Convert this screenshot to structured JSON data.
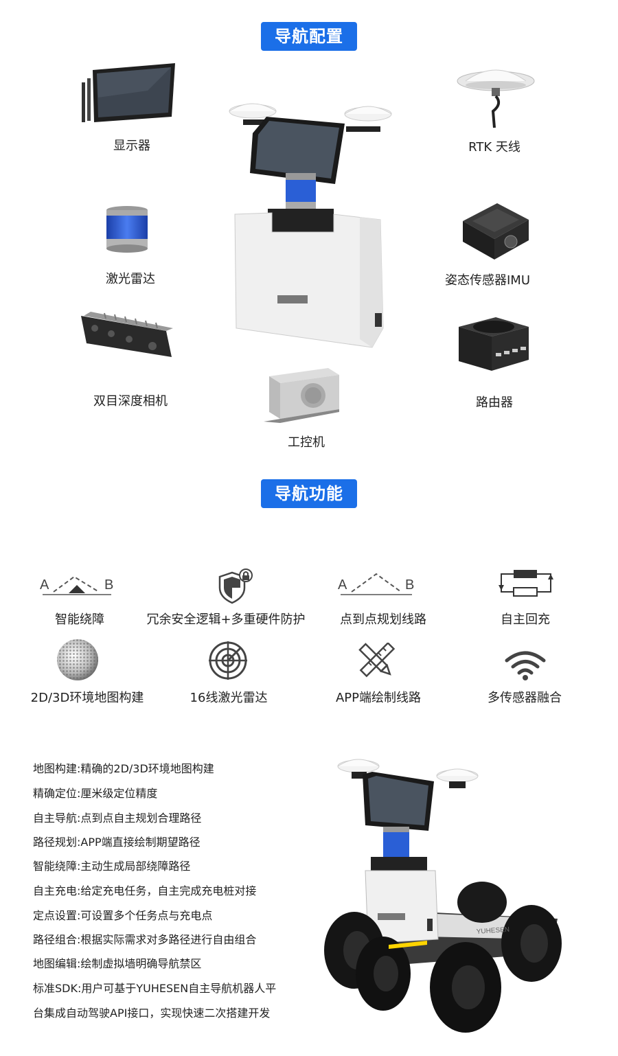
{
  "sections": {
    "config_title": "导航配置",
    "function_title": "导航功能"
  },
  "config_items": {
    "display": "显示器",
    "rtk_antenna": "RTK 天线",
    "lidar": "激光雷达",
    "imu": "姿态传感器IMU",
    "depth_camera": "双目深度相机",
    "router": "路由器",
    "ipc": "工控机"
  },
  "features": [
    {
      "label": "智能绕障",
      "icon": "obstacle-avoid-icon"
    },
    {
      "label": "冗余安全逻辑+多重硬件防护",
      "icon": "shield-lock-icon"
    },
    {
      "label": "点到点规划线路",
      "icon": "point-to-point-icon"
    },
    {
      "label": "自主回充",
      "icon": "battery-recharge-icon"
    },
    {
      "label": "2D/3D环境地图构建",
      "icon": "sphere-map-icon"
    },
    {
      "label": "16线激光雷达",
      "icon": "radar-icon"
    },
    {
      "label": "APP端绘制线路",
      "icon": "ruler-pencil-icon"
    },
    {
      "label": "多传感器融合",
      "icon": "wifi-icon"
    }
  ],
  "icon_letters": {
    "a": "A",
    "b": "B"
  },
  "descriptions": [
    "地图构建:精确的2D/3D环境地图构建",
    "精确定位:厘米级定位精度",
    "自主导航:点到点自主规划合理路径",
    "路径规划:APP端直接绘制期望路径",
    "智能绕障:主动生成局部绕障路径",
    "自主充电:给定充电任务，自主完成充电桩对接",
    "定点设置:可设置多个任务点与充电点",
    "路径组合:根据实际需求对多路径进行自由组合",
    "地图编辑:绘制虚拟墙明确导航禁区",
    "标准SDK:用户可基于YUHESEN自主导航机器人平",
    "台集成自动驾驶API接口，实现快速二次搭建开发"
  ],
  "robot_brand": "YUHESEN",
  "colors": {
    "accent": "#1b6fe8",
    "lidar_blue": "#2a5fd6"
  }
}
